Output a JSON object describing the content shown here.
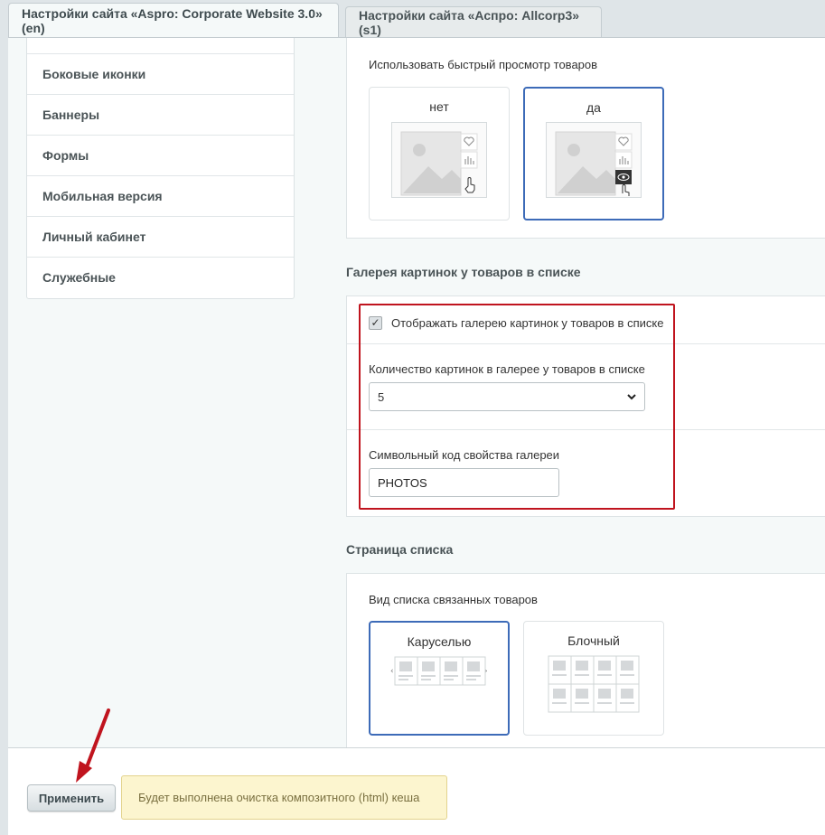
{
  "tabs": [
    {
      "label": "Настройки сайта «Aspro: Corporate Website 3.0» (en)",
      "active": true
    },
    {
      "label": "Настройки сайта «Аспро: Allcorp3» (s1)",
      "active": false
    }
  ],
  "sidebar": {
    "items": [
      {
        "label": "Боковые иконки"
      },
      {
        "label": "Баннеры"
      },
      {
        "label": "Формы"
      },
      {
        "label": "Мобильная версия"
      },
      {
        "label": "Личный кабинет"
      },
      {
        "label": "Служебные"
      }
    ]
  },
  "quick_view": {
    "label": "Использовать быстрый просмотр товаров",
    "options": [
      {
        "label": "нет",
        "selected": false
      },
      {
        "label": "да",
        "selected": true
      }
    ]
  },
  "gallery": {
    "title": "Галерея картинок у товаров в списке",
    "checkbox_label": "Отображать галерею картинок у товаров в списке",
    "checkbox_checked": true,
    "count_label": "Количество картинок в галерее у товаров в списке",
    "count_value": "5",
    "code_label": "Символьный код свойства галереи",
    "code_value": "PHOTOS"
  },
  "list_page": {
    "title": "Страница списка",
    "label": "Вид списка связанных товаров",
    "options": [
      {
        "label": "Каруселью",
        "selected": true
      },
      {
        "label": "Блочный",
        "selected": false
      }
    ]
  },
  "footer": {
    "apply_label": "Применить",
    "notice": "Будет выполнена очистка композитного (html) кеша"
  },
  "colors": {
    "accent_border": "#3d6bb8",
    "highlight_frame": "#c0141e"
  }
}
